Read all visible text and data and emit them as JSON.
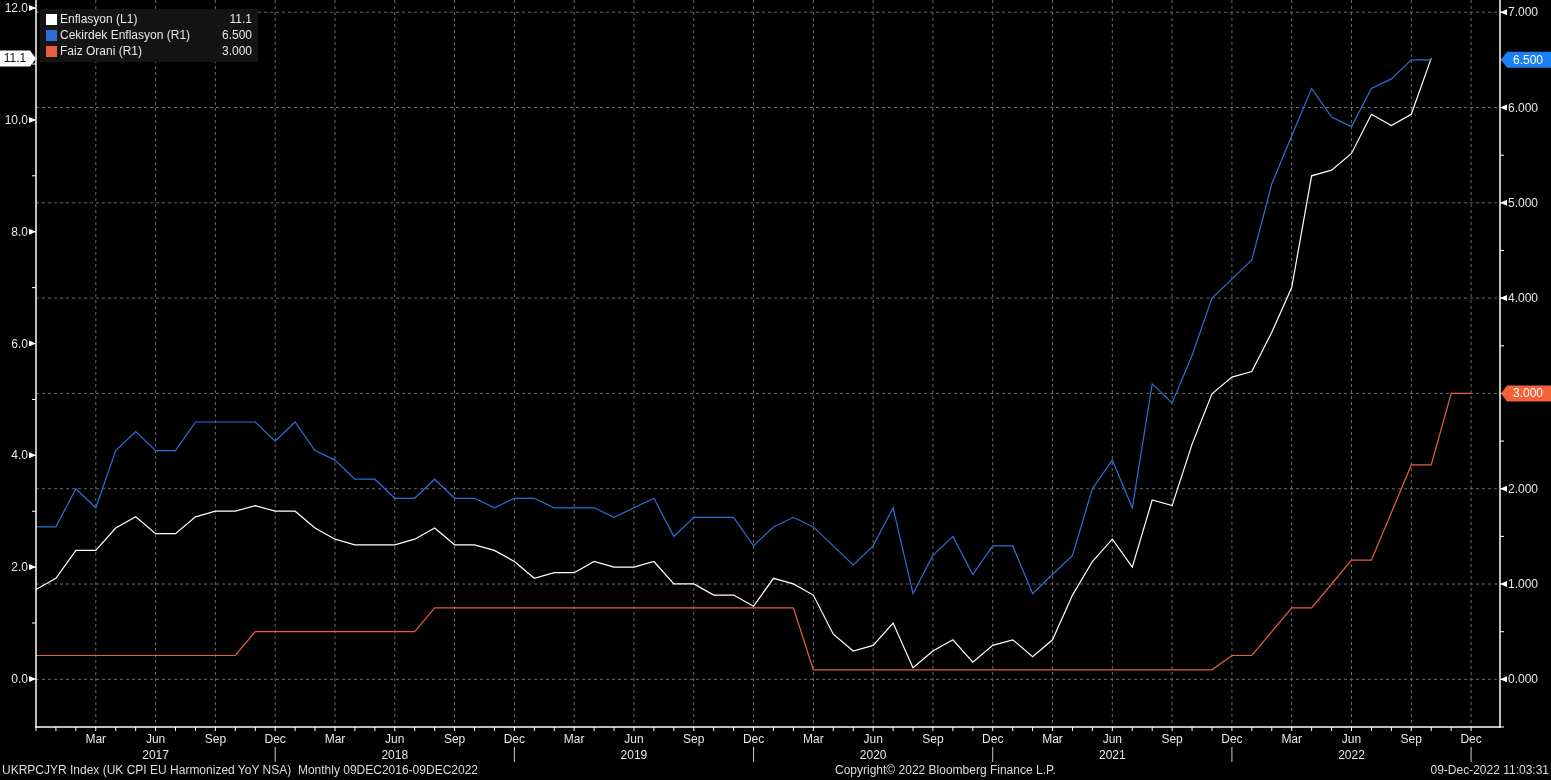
{
  "chart": {
    "legend_values": [
      "11.1",
      "6.500",
      "3.000"
    ],
    "last_value_labels": [
      {
        "text": "11.1",
        "color": "#ffffff"
      },
      {
        "text": "6.500",
        "color": "#1a7ff0"
      },
      {
        "text": "3.000",
        "color": "#f4623a"
      }
    ],
    "chart_data": {
      "type": "line",
      "grid": true,
      "categories": [
        null,
        null,
        null,
        "Mar",
        null,
        null,
        "Jun\n2017",
        null,
        null,
        "Sep",
        null,
        null,
        "Dec",
        null,
        null,
        "Mar",
        null,
        null,
        "Jun\n2018",
        null,
        null,
        "Sep",
        null,
        null,
        "Dec",
        null,
        null,
        "Mar",
        null,
        null,
        "Jun\n2019",
        null,
        null,
        "Sep",
        null,
        null,
        "Dec",
        null,
        null,
        "Mar",
        null,
        null,
        "Jun\n2020",
        null,
        null,
        "Sep",
        null,
        null,
        "Dec",
        null,
        null,
        "Mar",
        null,
        null,
        "Jun\n2021",
        null,
        null,
        "Sep",
        null,
        null,
        "Dec",
        null,
        null,
        "Mar",
        null,
        null,
        "Jun\n2022",
        null,
        null,
        "Sep",
        null,
        null,
        "Dec"
      ],
      "y2lim": [
        -0.5,
        7.128
      ],
      "y2ticks": [
        {
          "value": 7,
          "label": "7.000"
        },
        {
          "value": 6,
          "label": "6.000"
        },
        {
          "value": 5,
          "label": "5.000"
        },
        {
          "value": 4,
          "label": "4.000"
        },
        {
          "value": 2,
          "label": "2.000"
        },
        {
          "value": 1,
          "label": "1.000"
        },
        {
          "value": 0,
          "label": "0.000"
        }
      ],
      "series": [
        {
          "name": "Enflasyon (L1)",
          "color": "#ffffff",
          "values": [
            1.6,
            1.8,
            2.3,
            2.3,
            2.7,
            2.9,
            2.6,
            2.6,
            2.9,
            3.0,
            3.0,
            3.1,
            3.0,
            3.0,
            2.7,
            2.5,
            2.4,
            2.4,
            2.4,
            2.5,
            2.7,
            2.4,
            2.4,
            2.3,
            2.1,
            1.8,
            1.9,
            1.9,
            2.1,
            2.0,
            2.0,
            2.1,
            1.7,
            1.7,
            1.5,
            1.5,
            1.3,
            1.8,
            1.7,
            1.5,
            0.8,
            0.5,
            0.6,
            1.0,
            0.2,
            0.5,
            0.7,
            0.3,
            0.6,
            0.7,
            0.4,
            0.7,
            1.5,
            2.1,
            2.5,
            2.0,
            3.2,
            3.1,
            4.2,
            5.1,
            5.4,
            5.5,
            6.2,
            7.0,
            9.0,
            9.1,
            9.4,
            10.1,
            9.9,
            10.1,
            11.1,
            null,
            null
          ]
        },
        {
          "name": "Cekirdek Enflasyon (R1)",
          "color": "#2b6fd6",
          "axis": "y2",
          "values": [
            1.6,
            1.6,
            2.0,
            1.8,
            2.4,
            2.6,
            2.4,
            2.4,
            2.7,
            2.7,
            2.7,
            2.7,
            2.5,
            2.7,
            2.4,
            2.3,
            2.1,
            2.1,
            1.9,
            1.9,
            2.1,
            1.9,
            1.9,
            1.8,
            1.9,
            1.9,
            1.8,
            1.8,
            1.8,
            1.7,
            1.8,
            1.9,
            1.5,
            1.7,
            1.7,
            1.7,
            1.4,
            1.6,
            1.7,
            1.6,
            1.4,
            1.2,
            1.4,
            1.8,
            0.9,
            1.3,
            1.5,
            1.1,
            1.4,
            1.4,
            0.9,
            1.1,
            1.3,
            2.0,
            2.3,
            1.8,
            3.1,
            2.9,
            3.4,
            4.0,
            4.2,
            4.4,
            5.2,
            5.7,
            6.2,
            5.9,
            5.8,
            6.2,
            6.3,
            6.5,
            6.5,
            null,
            null
          ]
        },
        {
          "name": "Faiz Orani (R1)",
          "color": "#e8603c",
          "axis": "y2",
          "values": [
            0.25,
            0.25,
            0.25,
            0.25,
            0.25,
            0.25,
            0.25,
            0.25,
            0.25,
            0.25,
            0.25,
            0.5,
            0.5,
            0.5,
            0.5,
            0.5,
            0.5,
            0.5,
            0.5,
            0.5,
            0.75,
            0.75,
            0.75,
            0.75,
            0.75,
            0.75,
            0.75,
            0.75,
            0.75,
            0.75,
            0.75,
            0.75,
            0.75,
            0.75,
            0.75,
            0.75,
            0.75,
            0.75,
            0.75,
            0.1,
            0.1,
            0.1,
            0.1,
            0.1,
            0.1,
            0.1,
            0.1,
            0.1,
            0.1,
            0.1,
            0.1,
            0.1,
            0.1,
            0.1,
            0.1,
            0.1,
            0.1,
            0.1,
            0.1,
            0.1,
            0.25,
            0.25,
            0.5,
            0.75,
            0.75,
            1.0,
            1.25,
            1.25,
            1.75,
            2.25,
            2.25,
            3.0,
            3.0
          ]
        }
      ],
      "ylim": [
        -0.86,
        12.145
      ],
      "yticks": [
        {
          "value": 0,
          "label": "0.0"
        },
        {
          "value": 2,
          "label": "2.0"
        },
        {
          "value": 4,
          "label": "4.0"
        },
        {
          "value": 6,
          "label": "6.0"
        },
        {
          "value": 8,
          "label": "8.0"
        },
        {
          "value": 10,
          "label": "10.0"
        },
        {
          "value": 12,
          "label": "12.0"
        }
      ]
    }
  },
  "footer": {
    "source": "UKRPCJYR Index (UK CPI EU Harmonized YoY NSA)  Monthly 09DEC2016-09DEC2022",
    "copyright": "Copyright© 2022 Bloomberg Finance L.P.",
    "timestamp": "09-Dec-2022 11:03:31"
  }
}
